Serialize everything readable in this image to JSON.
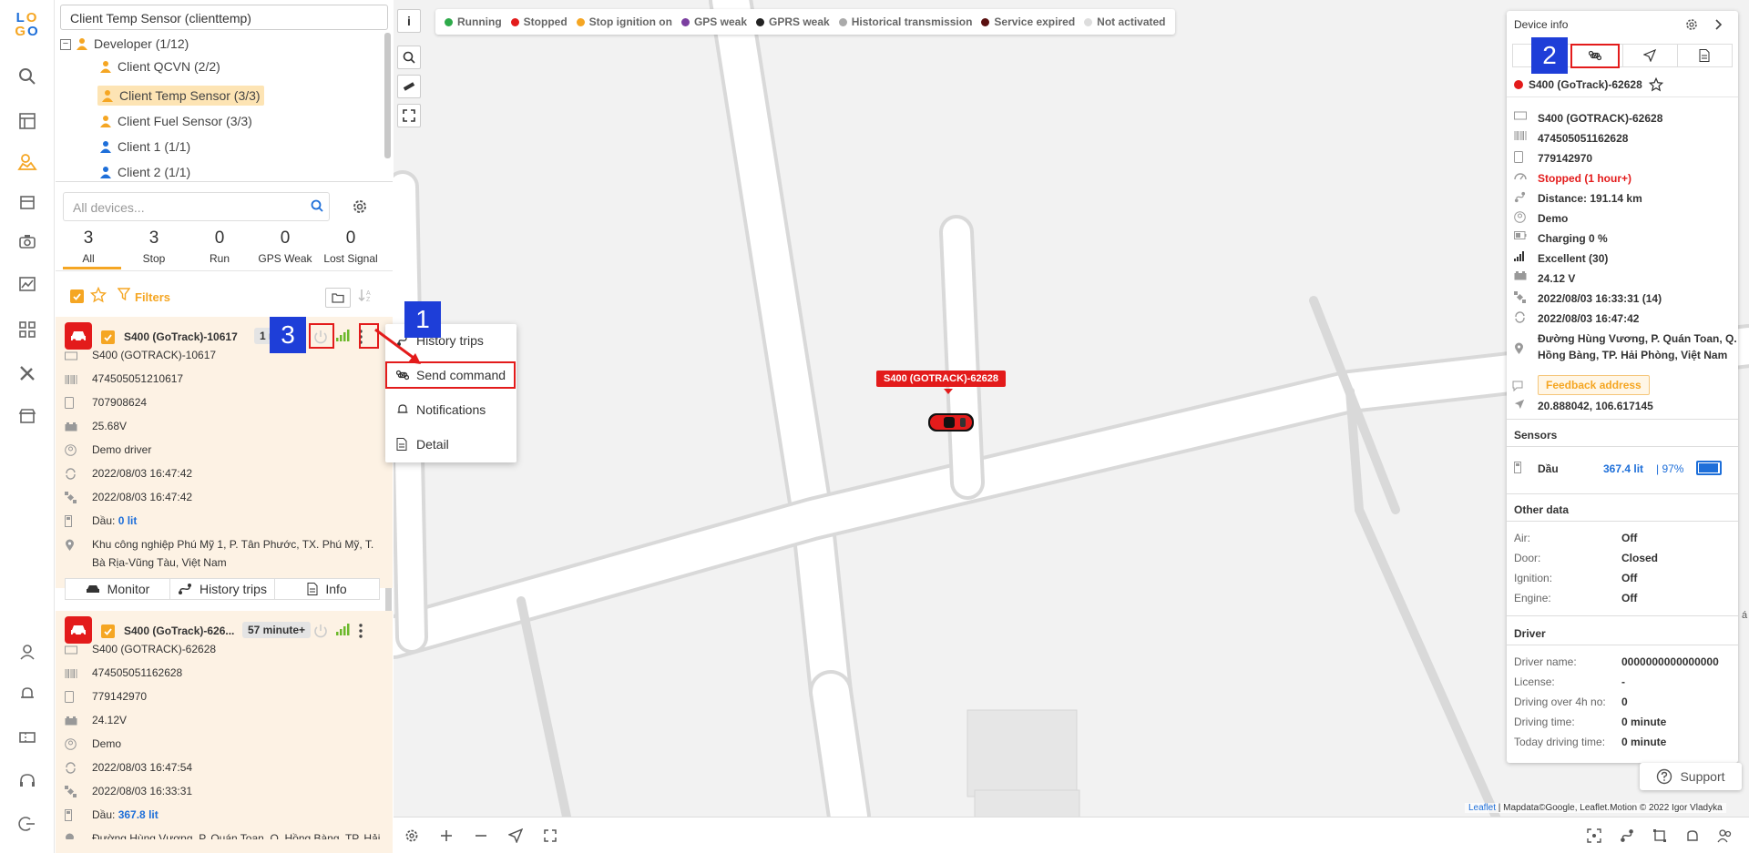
{
  "nav": {
    "logo": "LOGO"
  },
  "tree": {
    "top_label": "Client Temp Sensor (clienttemp)",
    "collapse_symbol": "−",
    "nodes": [
      {
        "label": "Developer (1/12)"
      },
      {
        "label": "Client QCVN (2/2)"
      },
      {
        "label": "Client Temp Sensor (3/3)"
      },
      {
        "label": "Client Fuel Sensor (3/3)"
      },
      {
        "label": "Client 1 (1/1)"
      },
      {
        "label": "Client 2 (1/1)"
      }
    ]
  },
  "devices": {
    "search_placeholder": "All devices...",
    "tabs": [
      {
        "count": "3",
        "label": "All"
      },
      {
        "count": "3",
        "label": "Stop"
      },
      {
        "count": "0",
        "label": "Run"
      },
      {
        "count": "0",
        "label": "GPS Weak"
      },
      {
        "count": "0",
        "label": "Lost Signal"
      }
    ],
    "filters_label": "Filters",
    "cards": [
      {
        "name": "S400 (GoTrack)-10617",
        "time_badge": "1 m",
        "plate": "S400 (GOTRACK)-10617",
        "imei": "474505051210617",
        "phone": "707908624",
        "voltage": "25.68V",
        "driver": "Demo driver",
        "time1": "2022/08/03 16:47:42",
        "time2": "2022/08/03 16:47:42",
        "fuel_label": "Dầu:",
        "fuel_value": "0 lit",
        "address_line1": "Khu công nghiệp Phú Mỹ 1, P. Tân Phước, TX. Phú Mỹ, T.",
        "address_line2": "Bà Rịa-Vũng Tàu, Việt Nam",
        "btn_monitor": "Monitor",
        "btn_history": "History trips",
        "btn_info": "Info"
      },
      {
        "name": "S400 (GoTrack)-626...",
        "time_badge": "57 minute+",
        "plate": "S400 (GOTRACK)-62628",
        "imei": "474505051162628",
        "phone": "779142970",
        "voltage": "24.12V",
        "driver": "Demo",
        "time1": "2022/08/03 16:47:54",
        "time2": "2022/08/03 16:33:31",
        "fuel_label": "Dầu:",
        "fuel_value": "367.8 lit",
        "address_line1": "Đường Hùng Vương, P. Quán Toan, Q. Hồng Bàng, TP. Hải"
      }
    ]
  },
  "context_menu": {
    "items": [
      {
        "label": "History trips",
        "icon": "route-icon"
      },
      {
        "label": "Send command",
        "icon": "command-icon"
      },
      {
        "label": "Notifications",
        "icon": "bell-icon"
      },
      {
        "label": "Detail",
        "icon": "document-icon"
      }
    ]
  },
  "legend": {
    "items": [
      {
        "label": "Running",
        "color": "#2eaa4a"
      },
      {
        "label": "Stopped",
        "color": "#e31b1b"
      },
      {
        "label": "Stop ignition on",
        "color": "#f5a623"
      },
      {
        "label": "GPS weak",
        "color": "#7b3fa0"
      },
      {
        "label": "GPRS weak",
        "color": "#222222"
      },
      {
        "label": "Historical transmission",
        "color": "#aaaaaa"
      },
      {
        "label": "Service expired",
        "color": "#5a1010"
      },
      {
        "label": "Not activated",
        "color": "#dddddd"
      }
    ]
  },
  "map": {
    "info_button": "i",
    "vehicle_label": "S400 (GOTRACK)-62628",
    "attribution_link": "Leaflet",
    "attribution_text": " | Mapdata©Google, Leaflet.Motion © 2022 Igor Vladyka",
    "edge_text": "á"
  },
  "device_info": {
    "title": "Device info",
    "name": "S400 (GoTrack)-62628",
    "rows": {
      "plate": "S400 (GOTRACK)-62628",
      "imei": "474505051162628",
      "phone": "779142970",
      "status": "Stopped  (1 hour+)",
      "distance": "Distance: 191.14 km",
      "driver": "Demo",
      "charging": "Charging 0 %",
      "signal": "Excellent (30)",
      "voltage": "24.12 V",
      "time1": "2022/08/03 16:33:31 (14)",
      "time2": "2022/08/03 16:47:42",
      "address_line1": "Đường Hùng Vương, P. Quán Toan, Q.",
      "address_line2": "Hồng Bàng, TP. Hải Phòng, Việt Nam",
      "feedback": "Feedback address",
      "coords": "20.888042, 106.617145"
    },
    "sensors_title": "Sensors",
    "sensor": {
      "name": "Dầu",
      "value": "367.4 lit",
      "percent": "| 97%",
      "level": 0.97
    },
    "other_title": "Other data",
    "other": [
      {
        "k": "Air:",
        "v": "Off"
      },
      {
        "k": "Door:",
        "v": "Closed"
      },
      {
        "k": "Ignition:",
        "v": "Off"
      },
      {
        "k": "Engine:",
        "v": "Off"
      }
    ],
    "driver_title": "Driver",
    "driver": [
      {
        "k": "Driver name:",
        "v": "0000000000000000"
      },
      {
        "k": "License:",
        "v": "-"
      },
      {
        "k": "Driving over 4h no:",
        "v": "0"
      },
      {
        "k": "Driving time:",
        "v": "0 minute"
      },
      {
        "k": "Today driving time:",
        "v": "0 minute"
      }
    ]
  },
  "support_label": "Support",
  "annotations": [
    "1",
    "2",
    "3"
  ]
}
